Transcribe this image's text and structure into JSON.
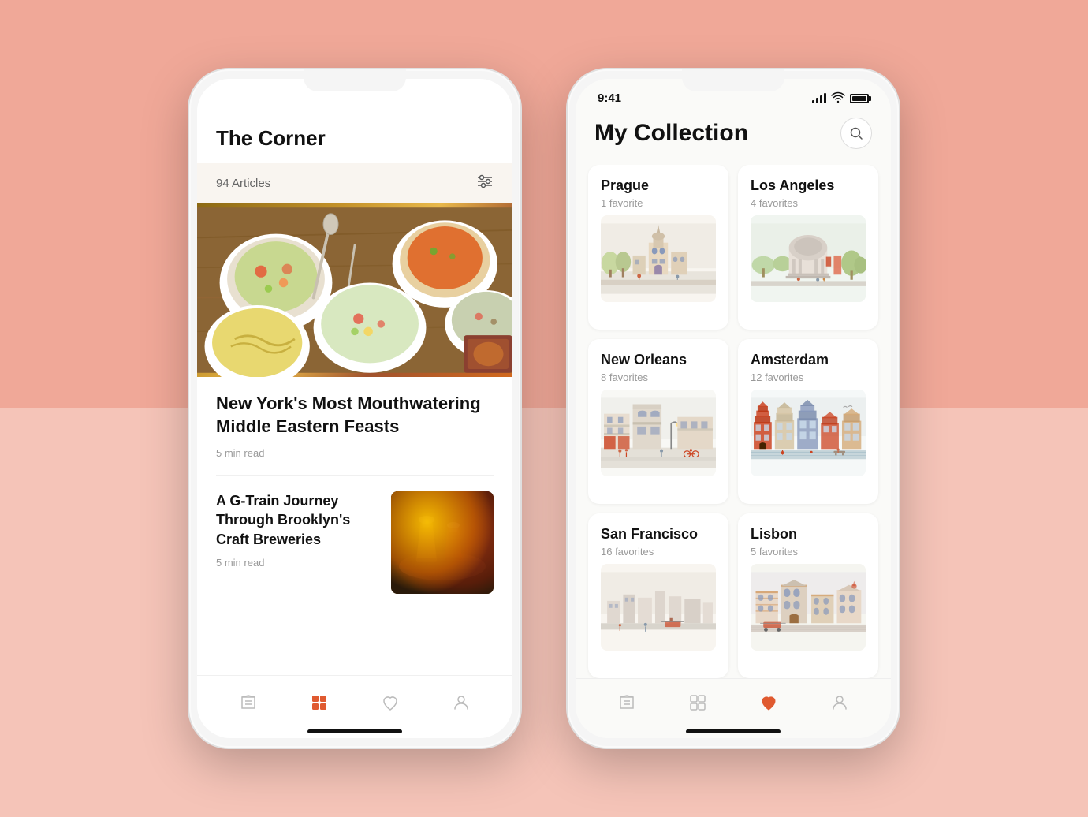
{
  "background": {
    "top_color": "#f0a898",
    "bottom_color": "#f5c4b8"
  },
  "left_phone": {
    "header": {
      "title": "The Corner"
    },
    "articles_bar": {
      "count": "94 Articles",
      "filter_label": "filter"
    },
    "main_article": {
      "title": "New York's Most Mouthwatering Middle Eastern Feasts",
      "read_time": "5 min read"
    },
    "second_article": {
      "title": "A G-Train Journey Through Brooklyn's Craft Breweries",
      "read_time": "5 min read"
    },
    "nav": {
      "items": [
        {
          "icon": "📖",
          "label": "read",
          "active": false
        },
        {
          "icon": "▦",
          "label": "browse",
          "active": true
        },
        {
          "icon": "♡",
          "label": "favorites",
          "active": false
        },
        {
          "icon": "👤",
          "label": "profile",
          "active": false
        }
      ]
    }
  },
  "right_phone": {
    "status_bar": {
      "time": "9:41"
    },
    "header": {
      "title": "My Collection",
      "search_label": "search"
    },
    "cities": [
      {
        "name": "Prague",
        "favorites": "1 favorite",
        "type": "prague"
      },
      {
        "name": "Los Angeles",
        "favorites": "4 favorites",
        "type": "la"
      },
      {
        "name": "New Orleans",
        "favorites": "8 favorites",
        "type": "new-orleans"
      },
      {
        "name": "Amsterdam",
        "favorites": "12 favorites",
        "type": "amsterdam"
      },
      {
        "name": "San Francisco",
        "favorites": "16 favorites",
        "type": "sf"
      },
      {
        "name": "Lisbon",
        "favorites": "5 favorites",
        "type": "lisbon"
      }
    ],
    "nav": {
      "items": [
        {
          "icon": "📖",
          "label": "read",
          "active": false
        },
        {
          "icon": "▦",
          "label": "browse",
          "active": false
        },
        {
          "icon": "♡",
          "label": "favorites",
          "active": true
        },
        {
          "icon": "👤",
          "label": "profile",
          "active": false
        }
      ]
    }
  }
}
